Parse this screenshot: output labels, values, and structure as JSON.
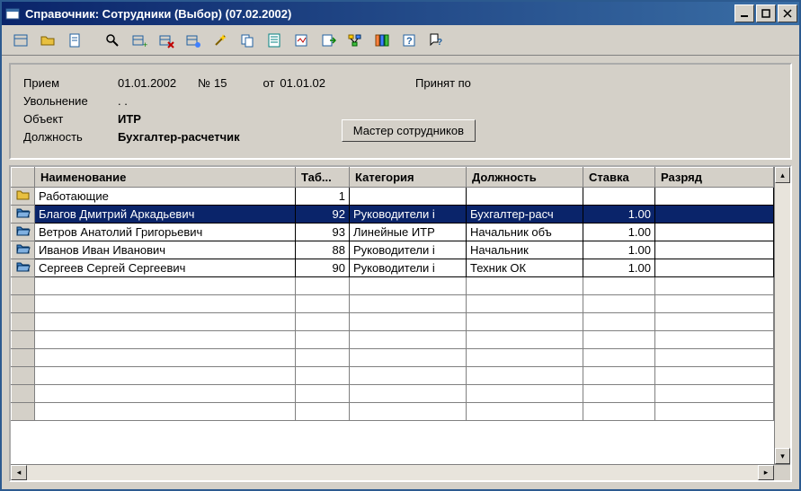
{
  "window": {
    "title": "Справочник: Сотрудники (Выбор) (07.02.2002)"
  },
  "info": {
    "hire_label": "Прием",
    "hire_date": "01.01.2002",
    "number_prefix": "№",
    "number": "15",
    "from_label": "от",
    "from_date": "01.01.02",
    "accepted_label": "Принят по",
    "fire_label": "Увольнение",
    "fire_date": ". .",
    "object_label": "Объект",
    "object_value": "ИТР",
    "position_label": "Должность",
    "position_value": "Бухгалтер-расчетчик",
    "master_button": "Мастер сотрудников"
  },
  "columns": {
    "name": "Наименование",
    "tab": "Таб...",
    "category": "Категория",
    "position": "Должность",
    "rate": "Ставка",
    "grade": "Разряд"
  },
  "rows": [
    {
      "icon": "closed",
      "name": "Работающие",
      "tab": "1",
      "category": "",
      "position": "",
      "rate": "",
      "grade": "",
      "selected": false
    },
    {
      "icon": "open",
      "name": "Благов Дмитрий Аркадьевич",
      "tab": "92",
      "category": "Руководители і",
      "position": "Бухгалтер-расч",
      "rate": "1.00",
      "grade": "",
      "selected": true
    },
    {
      "icon": "open",
      "name": "Ветров Анатолий Григорьевич",
      "tab": "93",
      "category": "Линейные ИТР",
      "position": "Начальник объ",
      "rate": "1.00",
      "grade": "",
      "selected": false
    },
    {
      "icon": "open",
      "name": "Иванов Иван Иванович",
      "tab": "88",
      "category": "Руководители і",
      "position": "Начальник",
      "rate": "1.00",
      "grade": "",
      "selected": false
    },
    {
      "icon": "open",
      "name": "Сергеев Сергей Сергеевич",
      "tab": "90",
      "category": "Руководители і",
      "position": "Техник ОК",
      "rate": "1.00",
      "grade": "",
      "selected": false
    }
  ],
  "empty_rows": 8
}
